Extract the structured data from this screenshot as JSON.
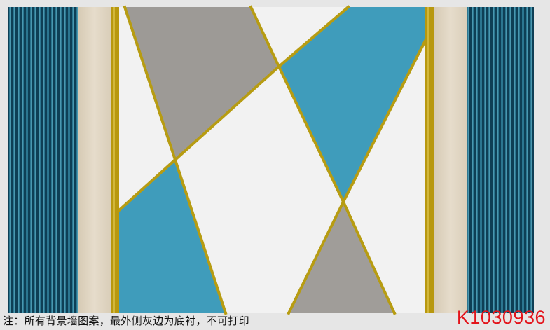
{
  "note": "注：所有背景墙图案，最外侧灰边为底衬，不可打印",
  "product_code": "K1030936",
  "colors": {
    "stripe_dark": "#0e3f55",
    "stripe_light": "#2f7f98",
    "beige": "#e3d8c5",
    "gold": "#b79c12",
    "grey": "#9d9a96",
    "blue": "#3f9cbb",
    "white": "#f2f2f2",
    "note_text": "#111111",
    "code_text": "#e3141b"
  }
}
